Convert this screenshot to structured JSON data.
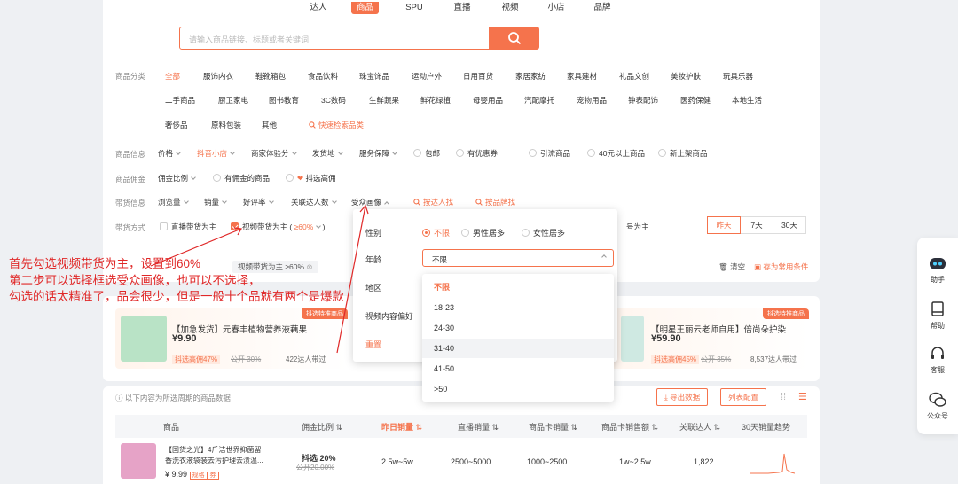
{
  "top_tabs": [
    "达人",
    "商品",
    "SPU",
    "直播",
    "视频",
    "小店",
    "品牌"
  ],
  "search": {
    "placeholder": "请输入商品链接、标题或者关键词"
  },
  "category": {
    "label": "商品分类",
    "row1": [
      "全部",
      "服饰内衣",
      "鞋靴箱包",
      "食品饮料",
      "珠宝饰品",
      "运动户外",
      "日用百货",
      "家居家纺",
      "家具建材",
      "礼品文创",
      "美妆护肤",
      "玩具乐器"
    ],
    "row2": [
      "二手商品",
      "厨卫家电",
      "图书教育",
      "3C数码",
      "生鲜蔬果",
      "鲜花绿植",
      "母婴用品",
      "汽配摩托",
      "宠物用品",
      "钟表配饰",
      "医药保健",
      "本地生活"
    ],
    "row3": [
      "奢侈品",
      "原料包装",
      "其他"
    ],
    "quick": "快速检索品类"
  },
  "product_info": {
    "label": "商品信息",
    "items": [
      "价格",
      "抖音小店",
      "商家体验分",
      "发货地",
      "服务保障",
      "包邮",
      "有优惠券",
      "引流商品",
      "40元以上商品",
      "新上架商品"
    ]
  },
  "commission": {
    "label": "商品佣金",
    "items": [
      "佣金比例",
      "有佣金的商品",
      "抖选高佣"
    ]
  },
  "sales_info": {
    "label": "带货信息",
    "items": [
      "浏览量",
      "销量",
      "好评率",
      "关联达人数",
      "受众画像"
    ],
    "links": [
      "按达人找",
      "按品牌找"
    ]
  },
  "sales_mode": {
    "label": "带货方式",
    "items": [
      "直播带货为主",
      "视频带货为主",
      "≥60%",
      "号为主"
    ]
  },
  "day_buttons": [
    "昨天",
    "7天",
    "30天"
  ],
  "selected_tags": [
    "视频带货为主 ≥60%"
  ],
  "actions": {
    "clear": "清空",
    "save": "存为常用条件"
  },
  "audience_popup": {
    "gender_label": "性别",
    "gender_options": [
      "不限",
      "男性居多",
      "女性居多"
    ],
    "age_label": "年龄",
    "age_value": "不限",
    "region_label": "地区",
    "pref_label": "视频内容偏好",
    "reset": "重置"
  },
  "age_dropdown": [
    "不限",
    "18-23",
    "24-30",
    "31-40",
    "41-50",
    ">50"
  ],
  "annotation": [
    "首先勾选视频带货为主，设置到60%",
    "第二步可以选择框选受众画像，也可以不选择，",
    "勾选的话太精准了，品会很少，但是一般十个品就有两个是爆款"
  ],
  "products": [
    {
      "badge": "抖选特推商品",
      "title": "【加急发货】元春丰植物营养液藕果...",
      "price": "¥9.90",
      "commission": "抖选高佣47%",
      "old": "公开 30%",
      "reach": "422达人带过"
    },
    {
      "badge": "抖选特推商品",
      "title": "【明星王丽云老师自用】倍尚朵护染...",
      "price": "¥59.90",
      "commission": "抖选高佣45%",
      "old": "公开 35%",
      "reach": "8,537达人带过"
    }
  ],
  "list_note": "以下内容为所选周期的商品数据",
  "list_buttons": {
    "export": "导出数据",
    "columns": "列表配置"
  },
  "table": {
    "headers": [
      "商品",
      "佣金比例",
      "昨日销量",
      "直播销量",
      "商品卡销量",
      "商品卡销售额",
      "关联达人",
      "30天销量趋势"
    ],
    "row": {
      "title1": "【国货之光】4斤洁世界抑菌留",
      "title2": "香洗衣液袋装去污护理去渍温...",
      "price": "¥ 9.99",
      "tag1": "规格",
      "tag2": "券",
      "commission": "抖选 20%",
      "commission_old": "公开20.00%",
      "sales": "2.5w~5w",
      "live": "2500~5000",
      "card": "1000~2500",
      "card_amount": "1w~2.5w",
      "creators": "1,822"
    }
  },
  "sidebar": [
    "助手",
    "帮助",
    "客服",
    "公众号"
  ],
  "colors": {
    "accent": "#f5734c",
    "annotation": "#e02828"
  }
}
